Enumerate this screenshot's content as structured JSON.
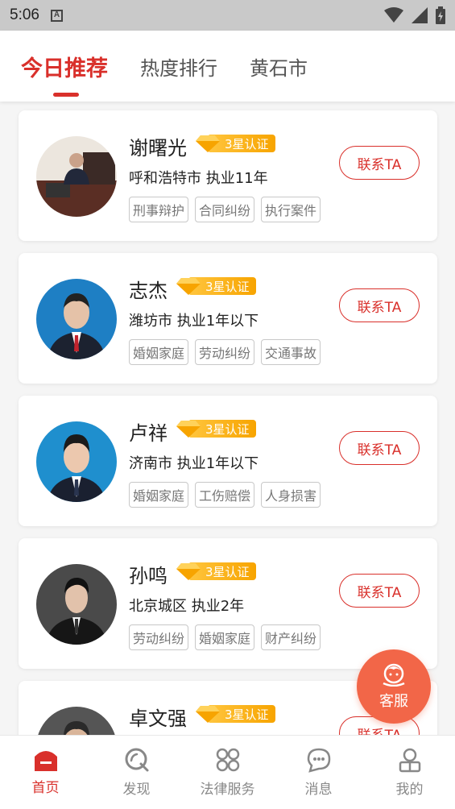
{
  "status_bar": {
    "time": "5:06",
    "notification_letter": "A"
  },
  "tabs": [
    {
      "label": "今日推荐",
      "active": true
    },
    {
      "label": "热度排行",
      "active": false
    },
    {
      "label": "黄石市",
      "active": false
    }
  ],
  "lawyers": [
    {
      "name": "谢曙光",
      "cert": "3星认证",
      "location": "呼和浩特市",
      "practice": "执业11年",
      "tags": [
        "刑事辩护",
        "合同纠纷",
        "执行案件"
      ],
      "contact": "联系TA"
    },
    {
      "name": "志杰",
      "cert": "3星认证",
      "location": "潍坊市",
      "practice": "执业1年以下",
      "tags": [
        "婚姻家庭",
        "劳动纠纷",
        "交通事故"
      ],
      "contact": "联系TA"
    },
    {
      "name": "卢祥",
      "cert": "3星认证",
      "location": "济南市",
      "practice": "执业1年以下",
      "tags": [
        "婚姻家庭",
        "工伤赔偿",
        "人身损害"
      ],
      "contact": "联系TA"
    },
    {
      "name": "孙鸣",
      "cert": "3星认证",
      "location": "北京城区",
      "practice": "执业2年",
      "tags": [
        "劳动纠纷",
        "婚姻家庭",
        "财产纠纷"
      ],
      "contact": "联系TA"
    },
    {
      "name": "卓文强",
      "cert": "3星认证",
      "location": "",
      "practice": "",
      "tags": [],
      "contact": "联系TA"
    }
  ],
  "float_service": {
    "label": "客服",
    "icon": "customer-service-icon"
  },
  "bottom_nav": [
    {
      "label": "首页",
      "icon": "home-icon",
      "active": true
    },
    {
      "label": "发现",
      "icon": "discover-icon",
      "active": false
    },
    {
      "label": "法律服务",
      "icon": "services-icon",
      "active": false
    },
    {
      "label": "消息",
      "icon": "message-icon",
      "active": false
    },
    {
      "label": "我的",
      "icon": "profile-icon",
      "active": false
    }
  ],
  "colors": {
    "accent": "#d9302b",
    "badge": "#ffc53d",
    "service": "#f26648"
  }
}
